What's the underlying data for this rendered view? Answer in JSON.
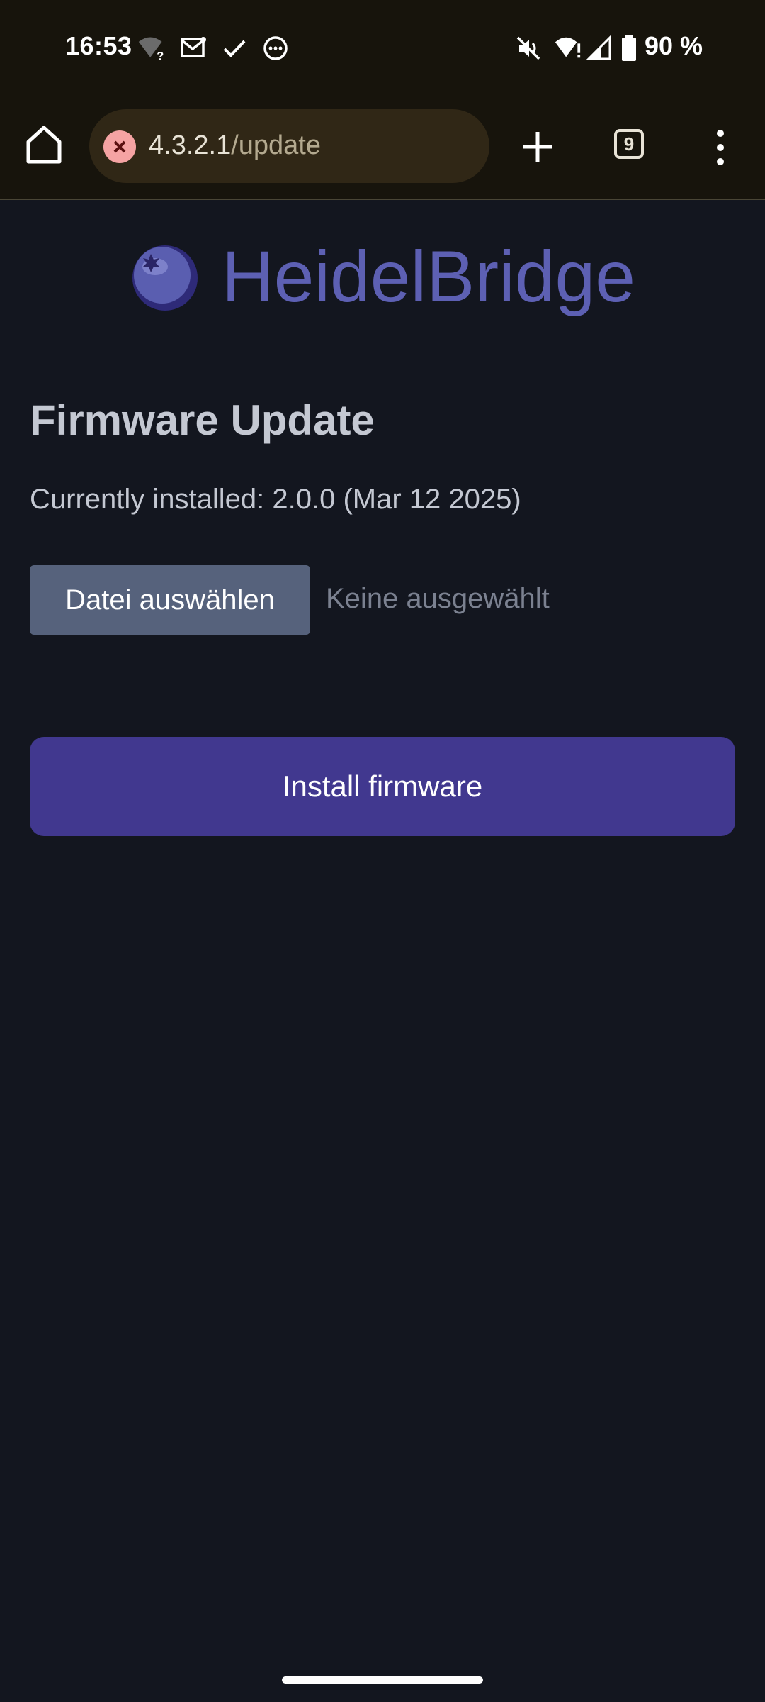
{
  "status_bar": {
    "time": "16:53",
    "battery_text": "90 %",
    "icons": [
      "wifi-unknown-icon",
      "mail-icon",
      "check-icon",
      "more-horiz-icon",
      "mute-icon",
      "wifi-icon",
      "signal-icon",
      "battery-icon"
    ]
  },
  "browser": {
    "url_host": "4.3.2.1",
    "url_path": "/update",
    "tab_count": "9",
    "security_icon": "not-secure-icon"
  },
  "brand": {
    "name": "HeidelBridge",
    "logo_icon": "blueberry-icon"
  },
  "page": {
    "title": "Firmware Update",
    "installed_text": "Currently installed: 2.0.0 (Mar 12 2025)",
    "file_button_label": "Datei auswählen",
    "file_status": "Keine ausgewählt",
    "install_button_label": "Install firmware"
  },
  "colors": {
    "background": "#13161f",
    "brand": "#5d60b3",
    "install_button": "#41388f",
    "file_button": "#56627c",
    "toolbar": "#17140c"
  }
}
